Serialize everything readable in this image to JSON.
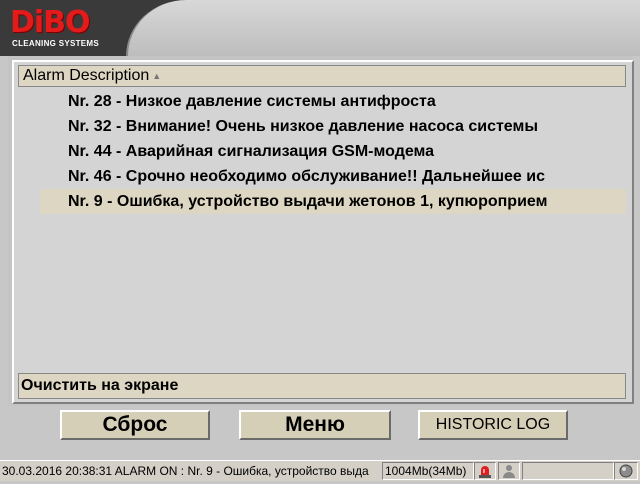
{
  "brand": {
    "name": "DiBO",
    "tagline": "CLEANING SYSTEMS"
  },
  "list": {
    "column_header": "Alarm Description",
    "rows": [
      "Nr. 28 - Низкое давление системы антифроста",
      "Nr. 32 - Внимание! Очень низкое давление насоса системы",
      "Nr. 44 - Аварийная сигнализация GSM-модема",
      "Nr. 46 - Срочно необходимо обслуживание!! Дальнейшее ис",
      "Nr. 9 - Ошибка, устройство выдачи жетонов 1, купюроприем"
    ],
    "selected_index": 4,
    "clear_label": "Очистить на экране"
  },
  "buttons": {
    "reset": "Сброс",
    "menu": "Меню",
    "historic_log": "HISTORIC LOG"
  },
  "statusbar": {
    "message": "30.03.2016 20:38:31 ALARM ON : Nr. 9 - Ошибка, устройство выда",
    "memory": "1004Mb(34Mb)"
  },
  "colors": {
    "brand_red": "#e41b1b",
    "selection": "#dcd6c2",
    "button_face": "#d6cfb8"
  },
  "icons": [
    "alarm-light-icon",
    "person-icon",
    "status-indicator-icon",
    "sort-arrow-icon"
  ]
}
